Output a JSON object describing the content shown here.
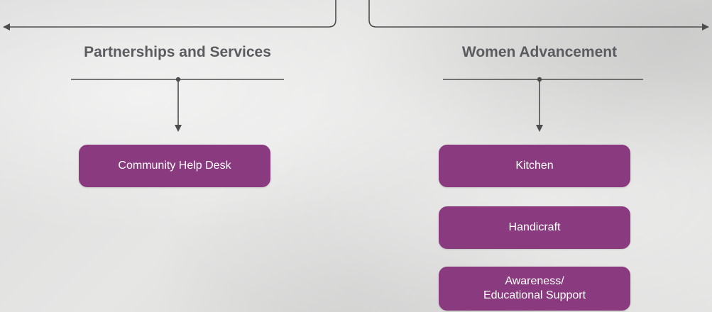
{
  "sections": [
    {
      "title": "Partnerships and Services",
      "items": [
        "Community Help Desk"
      ]
    },
    {
      "title": "Women Advancement",
      "items": [
        "Kitchen",
        "Handicraft",
        "Awareness/\nEducational Support"
      ]
    }
  ],
  "colors": {
    "box_fill": "#8a3a7e",
    "box_text": "#ffffff",
    "title_text": "#5a5a5f",
    "connector": "#4d4d4d"
  }
}
